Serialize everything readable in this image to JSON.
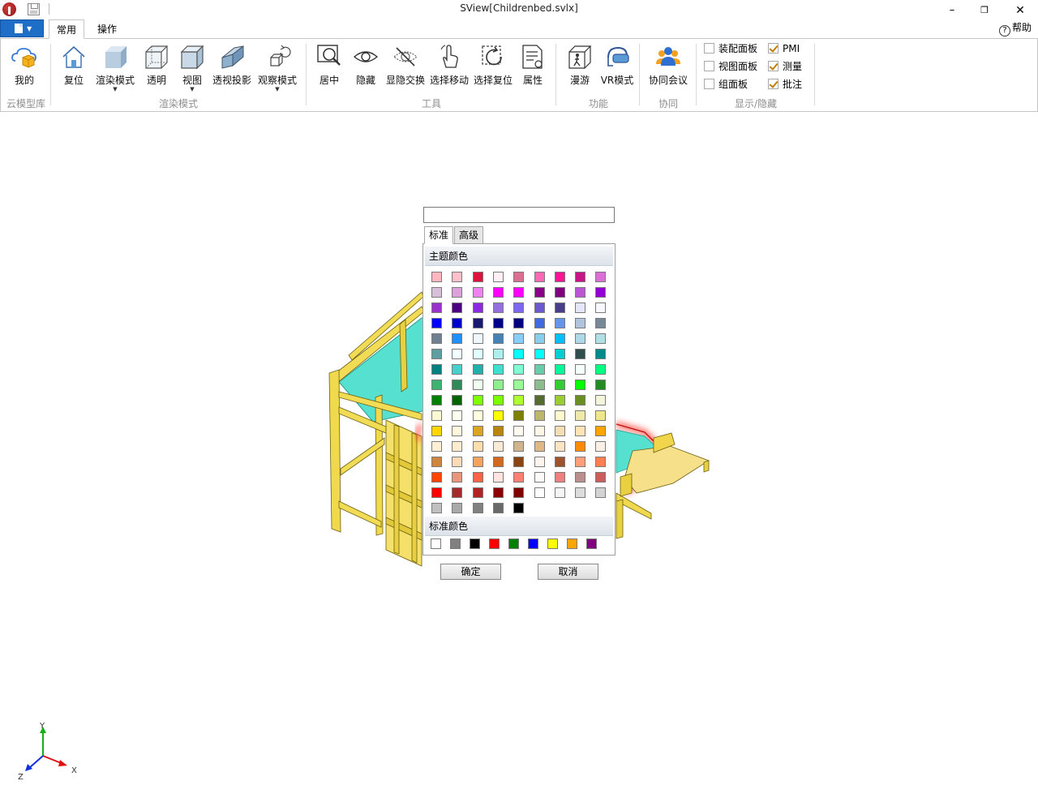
{
  "window": {
    "title": "SView[Childrenbed.svlx]",
    "minimize": "–",
    "restore": "❐",
    "close": "✕"
  },
  "menu": {
    "tabs": [
      "常用",
      "操作"
    ],
    "help_label": "帮助",
    "help_icon": "?"
  },
  "ribbon": {
    "groups": [
      "云模型库",
      "渲染模式",
      "工具",
      "功能",
      "协同",
      "显示/隐藏"
    ],
    "buttons": {
      "mine": "我的",
      "reset": "复位",
      "render_mode": "渲染模式",
      "transparent": "透明",
      "view": "视图",
      "perspective": "透视投影",
      "observe_mode": "观察模式",
      "center": "居中",
      "hide": "隐藏",
      "toggle_hide": "显隐交换",
      "select_move": "选择移动",
      "select_reset": "选择复位",
      "properties": "属性",
      "roam": "漫游",
      "vr_mode": "VR模式",
      "meeting": "协同会议"
    },
    "checkboxes": [
      {
        "label": "装配面板",
        "checked": false
      },
      {
        "label": "视图面板",
        "checked": false
      },
      {
        "label": "组面板",
        "checked": false
      },
      {
        "label": "PMI",
        "checked": true
      },
      {
        "label": "测量",
        "checked": true
      },
      {
        "label": "批注",
        "checked": true
      }
    ]
  },
  "color_picker": {
    "value": "",
    "tabs": {
      "standard": "标准",
      "advanced": "高级"
    },
    "theme_header": "主题颜色",
    "standard_header": "标准颜色",
    "theme_colors": [
      [
        "#FFB6C1",
        "#FFC0CB",
        "#DC143C",
        "#FFF0F5",
        "#DB7093",
        "#FF69B4",
        "#FF1493",
        "#C71585",
        "#DA70D6"
      ],
      [
        "#D8BFD8",
        "#DDA0DD",
        "#EE82EE",
        "#FF00FF",
        "#FF00FF",
        "#8B008B",
        "#800080",
        "#BA55D3",
        "#9400D3"
      ],
      [
        "#9932CC",
        "#4B0082",
        "#8A2BE2",
        "#9370DB",
        "#7B68EE",
        "#6A5ACD",
        "#483D8B",
        "#E6E6FA",
        "#F8F8FF"
      ],
      [
        "#0000FF",
        "#0000CD",
        "#191970",
        "#00008B",
        "#000080",
        "#4169E1",
        "#6495ED",
        "#B0C4DE",
        "#778899"
      ],
      [
        "#708090",
        "#1E90FF",
        "#F0F8FF",
        "#4682B4",
        "#87CEFA",
        "#87CEEB",
        "#00BFFF",
        "#ADD8E6",
        "#B0E0E6"
      ],
      [
        "#5F9EA0",
        "#F0FFFF",
        "#E0FFFF",
        "#AFEEEE",
        "#00FFFF",
        "#00FFFF",
        "#00CED1",
        "#2F4F4F",
        "#008B8B"
      ],
      [
        "#008080",
        "#48D1CC",
        "#20B2AA",
        "#40E0D0",
        "#7FFFD4",
        "#66CDAA",
        "#00FA9A",
        "#F5FFFA",
        "#00FF7F"
      ],
      [
        "#3CB371",
        "#2E8B57",
        "#F0FFF0",
        "#90EE90",
        "#98FB98",
        "#8FBC8F",
        "#32CD32",
        "#00FF00",
        "#228B22"
      ],
      [
        "#008000",
        "#006400",
        "#7FFF00",
        "#7CFC00",
        "#ADFF2F",
        "#556B2F",
        "#9ACD32",
        "#6B8E23",
        "#F5F5DC"
      ],
      [
        "#FAFAD2",
        "#FFFFF0",
        "#FFFFE0",
        "#FFFF00",
        "#808000",
        "#BDB76B",
        "#FFFACD",
        "#EEE8AA",
        "#F0E68C"
      ],
      [
        "#FFD700",
        "#FFF8DC",
        "#DAA520",
        "#B8860B",
        "#FFFAF0",
        "#FDF5E6",
        "#F5DEB3",
        "#FFE4B5",
        "#FFA500"
      ],
      [
        "#FFEFD5",
        "#FFEBCD",
        "#FFDEAD",
        "#FAEBD7",
        "#D2B48C",
        "#DEB887",
        "#FFE4C4",
        "#FF8C00",
        "#FAF0E6"
      ],
      [
        "#CD853F",
        "#FFDAB9",
        "#F4A460",
        "#D2691E",
        "#8B4513",
        "#FFF5EE",
        "#A0522D",
        "#FFA07A",
        "#FF7F50"
      ],
      [
        "#FF4500",
        "#E9967A",
        "#FF6347",
        "#FFE4E1",
        "#FA8072",
        "#FFFAFA",
        "#F08080",
        "#BC8F8F",
        "#CD5C5C"
      ],
      [
        "#FF0000",
        "#A52A2A",
        "#B22222",
        "#8B0000",
        "#800000",
        "#FFFFFF",
        "#F5F5F5",
        "#DCDCDC",
        "#D3D3D3"
      ],
      [
        "#C0C0C0",
        "#A9A9A9",
        "#808080",
        "#696969",
        "#000000"
      ]
    ],
    "standard_colors": [
      "#FFFFFF",
      "#808080",
      "#000000",
      "#FF0000",
      "#008000",
      "#0000FF",
      "#FFFF00",
      "#FFA500",
      "#800080"
    ],
    "ok_label": "确定",
    "cancel_label": "取消"
  },
  "axis": {
    "x_label": "X",
    "y_label": "Y",
    "z_label": "Z"
  },
  "icons": [
    "app-logo-icon",
    "save-icon",
    "file-doc-icon",
    "help-icon",
    "cloud-box-icon",
    "home-icon",
    "cube-render-icon",
    "cube-transparent-icon",
    "cube-view-icon",
    "perspective-icon",
    "orbit-icon",
    "zoom-center-icon",
    "eye-icon",
    "eye-slash-icon",
    "hand-move-icon",
    "select-reset-icon",
    "properties-icon",
    "walk-icon",
    "vr-headset-icon",
    "meeting-icon"
  ]
}
